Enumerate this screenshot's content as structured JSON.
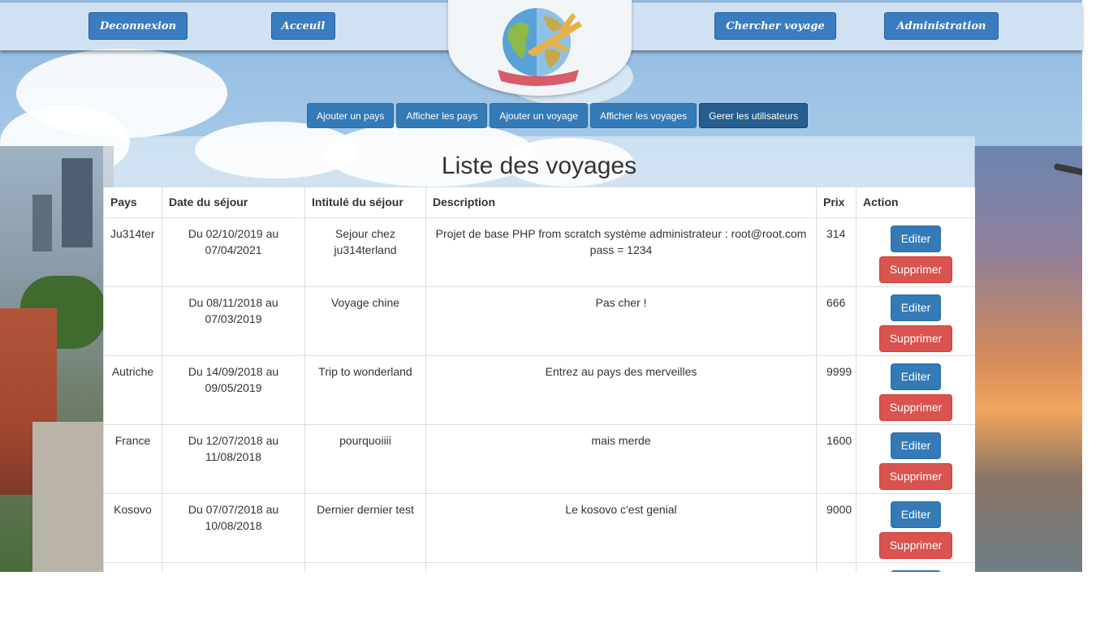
{
  "nav": {
    "deconnexion": "Deconnexion",
    "accueil": "Acceuil",
    "chercher": "Chercher voyage",
    "administration": "Administration"
  },
  "logo": {
    "icon": "globe-plane-logo"
  },
  "admin_nav": [
    {
      "label": "Ajouter un pays"
    },
    {
      "label": "Afficher les pays"
    },
    {
      "label": "Ajouter un voyage"
    },
    {
      "label": "Afficher les voyages"
    },
    {
      "label": "Gerer les utilisateurs"
    }
  ],
  "page": {
    "title": "Liste des voyages"
  },
  "table": {
    "headers": {
      "pays": "Pays",
      "date": "Date du séjour",
      "intitule": "Intitulé du séjour",
      "description": "Description",
      "prix": "Prix",
      "action": "Action"
    },
    "edit_label": "Editer",
    "delete_label": "Supprimer",
    "rows": [
      {
        "pays": "Ju314ter",
        "date": "Du 02/10/2019 au 07/04/2021",
        "intitule": "Sejour chez ju314terland",
        "description": "Projet de base PHP from scratch système administrateur : root@root.com pass = 1234",
        "prix": "314"
      },
      {
        "pays": "",
        "date": "Du 08/11/2018 au 07/03/2019",
        "intitule": "Voyage chine",
        "description": "Pas cher !",
        "prix": "666"
      },
      {
        "pays": "Autriche",
        "date": "Du 14/09/2018 au 09/05/2019",
        "intitule": "Trip to wonderland",
        "description": "Entrez au pays des merveilles",
        "prix": "9999"
      },
      {
        "pays": "France",
        "date": "Du 12/07/2018 au 11/08/2018",
        "intitule": "pourquoiiii",
        "description": "mais merde",
        "prix": "1600"
      },
      {
        "pays": "Kosovo",
        "date": "Du 07/07/2018 au 10/08/2018",
        "intitule": "Dernier dernier test",
        "description": "Le kosovo c'est genial",
        "prix": "9000"
      }
    ]
  },
  "colors": {
    "primary": "#337ab7",
    "danger": "#d9534f",
    "primary_active": "#285e8e"
  }
}
